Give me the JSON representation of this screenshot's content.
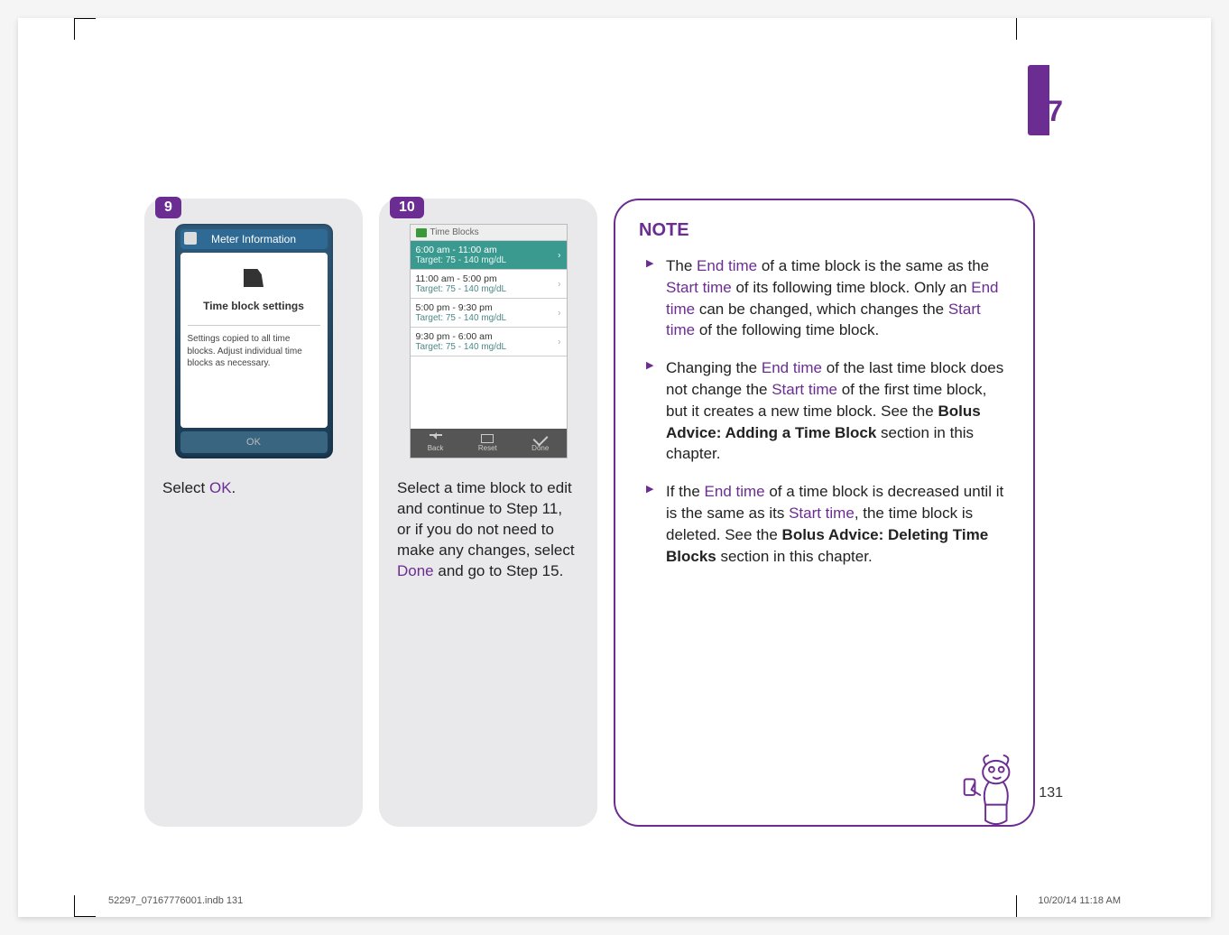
{
  "chapter": "7",
  "page_number": "131",
  "footer": {
    "file": "52297_07167776001.indb   131",
    "date": "10/20/14   11:18 AM"
  },
  "step9": {
    "num": "9",
    "screen": {
      "header": "Meter Information",
      "title": "Time block settings",
      "message": "Settings copied to all time blocks. Adjust individual time blocks as necessary.",
      "ok": "OK"
    },
    "caption_pre": "Select ",
    "caption_hl": "OK",
    "caption_post": "."
  },
  "step10": {
    "num": "10",
    "screen": {
      "title": "Time Blocks",
      "rows": [
        {
          "time": "6:00 am - 11:00 am",
          "tgt": "Target: 75 - 140 mg/dL"
        },
        {
          "time": "11:00 am - 5:00 pm",
          "tgt": "Target: 75 - 140 mg/dL"
        },
        {
          "time": "5:00 pm - 9:30 pm",
          "tgt": "Target: 75 - 140 mg/dL"
        },
        {
          "time": "9:30 pm - 6:00 am",
          "tgt": "Target: 75 - 140 mg/dL"
        }
      ],
      "foot": {
        "back": "Back",
        "reset": "Reset",
        "done": "Done"
      }
    },
    "caption_1": "Select a time block to edit and continue to Step 11, or if you do not need to make any changes, select ",
    "caption_hl": "Done",
    "caption_2": " and go to Step 15."
  },
  "note": {
    "title": "NOTE",
    "items": {
      "a": {
        "t1": "The ",
        "h1": "End time",
        "t2": " of a time block is the same as the ",
        "h2": "Start time",
        "t3": " of its following time block. Only an ",
        "h3": "End time",
        "t4": " can be changed, which changes the ",
        "h4": "Start time",
        "t5": " of the following time block."
      },
      "b": {
        "t1": "Changing the ",
        "h1": "End time",
        "t2": " of the last time block does not change the ",
        "h2": "Start time",
        "t3": " of the first time block, but it creates a new time block. See the ",
        "b1": "Bolus Advice: Adding a Time Block",
        "t4": " section in this chapter."
      },
      "c": {
        "t1": "If the ",
        "h1": "End time",
        "t2": " of a time block is decreased until it is the same as its ",
        "h2": "Start time",
        "t3": ", the time block is deleted. See the ",
        "b1": "Bolus Advice: Deleting Time Blocks",
        "t4": " section in this chapter."
      }
    }
  }
}
